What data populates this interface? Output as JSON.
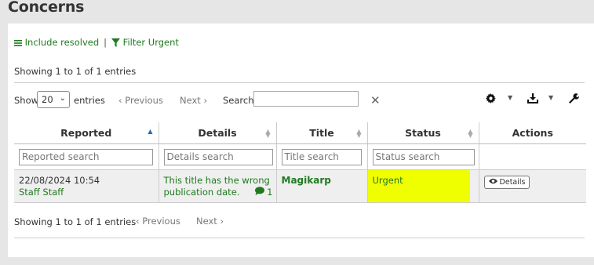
{
  "page": {
    "title": "Concerns"
  },
  "top_links": {
    "include_resolved": "Include resolved",
    "separator": "|",
    "filter_urgent": "Filter Urgent"
  },
  "info_top": "Showing 1 to 1 of 1 entries",
  "info_bottom": "Showing 1 to 1 of 1 entries",
  "length": {
    "show": "Show",
    "value": "20",
    "entries": "entries"
  },
  "pagination": {
    "previous": "Previous",
    "next": "Next"
  },
  "search": {
    "label": "Search:",
    "value": ""
  },
  "toolbar_icons": [
    "gear-icon",
    "download-icon",
    "wrench-icon"
  ],
  "table": {
    "columns": [
      "Reported",
      "Details",
      "Title",
      "Status",
      "Actions"
    ],
    "filters": [
      "Reported search",
      "Details search",
      "Title search",
      "Status search"
    ],
    "rows": [
      {
        "reported_date": "22/08/2024 10:54",
        "reported_by": "Staff Staff",
        "details_line1": "This title has the wrong",
        "details_line2": "publication date.",
        "comment_count": "1",
        "title": "Magikarp",
        "status": "Urgent",
        "action": "Details"
      }
    ]
  },
  "colors": {
    "link": "#1f7a1f",
    "urgent_bg": "#f0ff00",
    "sort_active": "#2a6ab4"
  }
}
